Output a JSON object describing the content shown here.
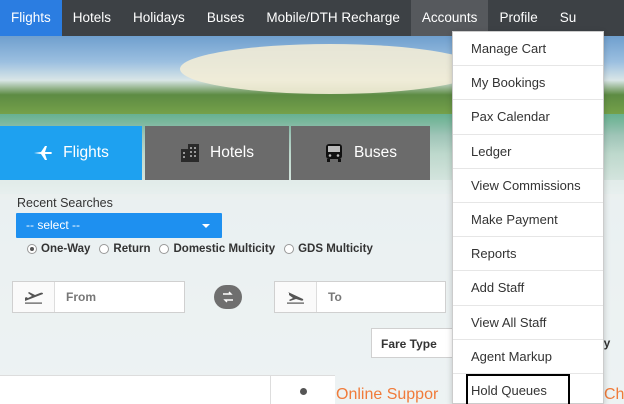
{
  "nav": {
    "items": [
      "Flights",
      "Hotels",
      "Holidays",
      "Buses",
      "Mobile/DTH Recharge",
      "Accounts",
      "Profile",
      "Su"
    ],
    "active": "Flights",
    "open": "Accounts"
  },
  "tabs": {
    "flights": "Flights",
    "hotels": "Hotels",
    "buses": "Buses"
  },
  "form": {
    "recent_label": "Recent Searches",
    "select_value": "-- select --",
    "trip_types": [
      "One-Way",
      "Return",
      "Domestic Multicity",
      "GDS Multicity"
    ],
    "selected_trip": "One-Way",
    "from_placeholder": "From",
    "to_placeholder": "To",
    "fare_type": "Fare Type",
    "class_clip": "my"
  },
  "footer": {
    "support_text": "Online Suppor",
    "support_tail": "Ch"
  },
  "accounts_menu": {
    "items": [
      "Manage Cart",
      "My Bookings",
      "Pax Calendar",
      "Ledger",
      "View Commissions",
      "Make Payment",
      "Reports",
      "Add Staff",
      "View All Staff",
      "Agent Markup",
      "Hold Queues"
    ],
    "highlighted": "Hold Queues"
  },
  "colors": {
    "nav_bg": "#3d4145",
    "active_blue": "#2b7de1",
    "tab_blue": "#1ea1f0",
    "tab_gray": "#6b6b6b",
    "support_orange": "#f07b3a"
  }
}
